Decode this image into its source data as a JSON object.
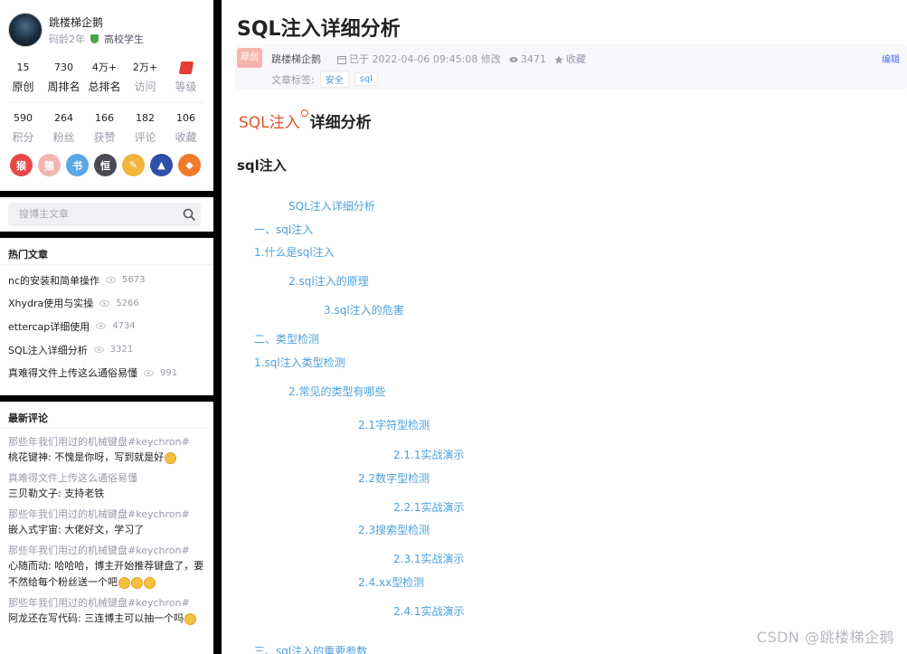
{
  "profile": {
    "name": "跳楼梯企鹅",
    "code_age": "码龄2年",
    "badge": "高校学生",
    "stats_row1": [
      {
        "value": "15",
        "label": "原创"
      },
      {
        "value": "730",
        "label": "周排名"
      },
      {
        "value": "4万+",
        "label": "总排名"
      },
      {
        "value": "2万+",
        "label": "访问"
      },
      {
        "value": "",
        "label": "等级"
      }
    ],
    "stats_row2": [
      {
        "value": "590",
        "label": "积分"
      },
      {
        "value": "264",
        "label": "粉丝"
      },
      {
        "value": "166",
        "label": "获赞"
      },
      {
        "value": "182",
        "label": "评论"
      },
      {
        "value": "106",
        "label": "收藏"
      }
    ],
    "medals": [
      {
        "icon": "monkey-medal-icon",
        "color": "#e8484a",
        "glyph": "猴"
      },
      {
        "icon": "ape-medal-icon",
        "color": "#f0b6b0",
        "glyph": "猿"
      },
      {
        "icon": "book-medal-icon",
        "color": "#5aa7e6",
        "glyph": "书"
      },
      {
        "icon": "persist-medal-icon",
        "color": "#4a4a56",
        "glyph": "恒"
      },
      {
        "icon": "pen-medal-icon",
        "color": "#f2b63c",
        "glyph": "✎"
      },
      {
        "icon": "rocket-medal-icon",
        "color": "#2f4fa8",
        "glyph": "▲"
      },
      {
        "icon": "fire-medal-icon",
        "color": "#f07a2a",
        "glyph": "◆"
      }
    ]
  },
  "search": {
    "placeholder": "搜博主文章"
  },
  "hot_articles": {
    "title": "热门文章",
    "items": [
      {
        "title": "nc的安装和简单操作",
        "views": "5673"
      },
      {
        "title": "Xhydra使用与实操",
        "views": "5266"
      },
      {
        "title": "ettercap详细使用",
        "views": "4734"
      },
      {
        "title": "SQL注入详细分析",
        "views": "3321"
      },
      {
        "title": "真难得文件上传这么通俗易懂",
        "views": "991"
      }
    ]
  },
  "latest_comments": {
    "title": "最新评论",
    "items": [
      {
        "article": "那些年我们用过的机械键盘#keychron#",
        "text": "桃花键神: 不愧是你呀，写到就是好",
        "emojis": 1
      },
      {
        "article": "真难得文件上传这么通俗易懂",
        "text": "三贝勒文子: 支持老铁",
        "emojis": 0
      },
      {
        "article": "那些年我们用过的机械键盘#keychron#",
        "text": "嵌入式宇宙: 大佬好文，学习了",
        "emojis": 0
      },
      {
        "article": "那些年我们用过的机械键盘#keychron#",
        "text": "心随而动: 哈哈哈，博主开始推荐键盘了，要不然给每个粉丝送一个吧",
        "emojis": 3
      },
      {
        "article": "那些年我们用过的机械键盘#keychron#",
        "text": "阿龙还在写代码: 三连博主可以抽一个吗",
        "emojis": 1
      }
    ]
  },
  "article": {
    "title": "SQL注入详细分析",
    "tag_original": "原创",
    "author": "跳楼梯企鹅",
    "date": "已于 2022-04-06 09:45:08 修改",
    "views": "3471",
    "collect": "收藏",
    "edit": "编辑",
    "tags_label": "文章标签:",
    "tags": [
      "安全",
      "sql"
    ],
    "heading_red": "SQL注入",
    "heading_dark": "详细分析",
    "section": "sql注入",
    "toc": [
      "SQL注入详细分析",
      "一、sql注入",
      "1.什么是sql注入",
      "2.sql注入的原理",
      "3.sql注入的危害",
      "二、类型检测",
      "1.sql注入类型检测",
      "2.常见的类型有哪些",
      "2.1字符型检测",
      "2.1.1实战演示",
      "2.2数字型检测",
      "2.2.1实战演示",
      "2.3搜索型检测",
      "2.3.1实战演示",
      "2.4.xx型检测",
      "2.4.1实战演示",
      "三、sql注入的重要参数"
    ]
  },
  "watermark": "CSDN @跳楼梯企鹅"
}
